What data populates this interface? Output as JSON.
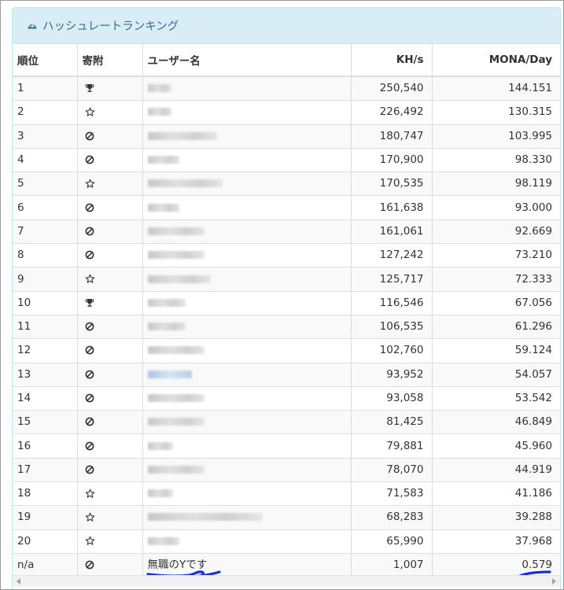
{
  "panel": {
    "title": "ハッシュレートランキング",
    "icon": "dashboard-icon",
    "accent_color": "#31708f",
    "heading_bg": "#d9edf7"
  },
  "table": {
    "headers": {
      "rank": "順位",
      "donation": "寄附",
      "username": "ユーザー名",
      "khs": "KH/s",
      "mona_day": "MONA/Day"
    },
    "rows": [
      {
        "rank": "1",
        "donation": "trophy",
        "khs": "250,540",
        "mona": "144.151"
      },
      {
        "rank": "2",
        "donation": "star",
        "khs": "226,492",
        "mona": "130.315"
      },
      {
        "rank": "3",
        "donation": "ban",
        "khs": "180,747",
        "mona": "103.995"
      },
      {
        "rank": "4",
        "donation": "ban",
        "khs": "170,900",
        "mona": "98.330"
      },
      {
        "rank": "5",
        "donation": "star",
        "khs": "170,535",
        "mona": "98.119"
      },
      {
        "rank": "6",
        "donation": "ban",
        "khs": "161,638",
        "mona": "93.000"
      },
      {
        "rank": "7",
        "donation": "ban",
        "khs": "161,061",
        "mona": "92.669"
      },
      {
        "rank": "8",
        "donation": "ban",
        "khs": "127,242",
        "mona": "73.210"
      },
      {
        "rank": "9",
        "donation": "star",
        "khs": "125,717",
        "mona": "72.333"
      },
      {
        "rank": "10",
        "donation": "trophy",
        "khs": "116,546",
        "mona": "67.056"
      },
      {
        "rank": "11",
        "donation": "ban",
        "khs": "106,535",
        "mona": "61.296"
      },
      {
        "rank": "12",
        "donation": "ban",
        "khs": "102,760",
        "mona": "59.124"
      },
      {
        "rank": "13",
        "donation": "ban",
        "khs": "93,952",
        "mona": "54.057"
      },
      {
        "rank": "14",
        "donation": "ban",
        "khs": "93,058",
        "mona": "53.542"
      },
      {
        "rank": "15",
        "donation": "ban",
        "khs": "81,425",
        "mona": "46.849"
      },
      {
        "rank": "16",
        "donation": "ban",
        "khs": "79,881",
        "mona": "45.960"
      },
      {
        "rank": "17",
        "donation": "ban",
        "khs": "78,070",
        "mona": "44.919"
      },
      {
        "rank": "18",
        "donation": "star",
        "khs": "71,583",
        "mona": "41.186"
      },
      {
        "rank": "19",
        "donation": "star",
        "khs": "68,283",
        "mona": "39.288"
      },
      {
        "rank": "20",
        "donation": "star",
        "khs": "65,990",
        "mona": "37.968"
      }
    ],
    "self_row": {
      "rank": "n/a",
      "donation": "ban",
      "username": "無職のYです",
      "khs": "1,007",
      "mona": "0.579"
    }
  },
  "annotation_color": "#1a2fd6"
}
